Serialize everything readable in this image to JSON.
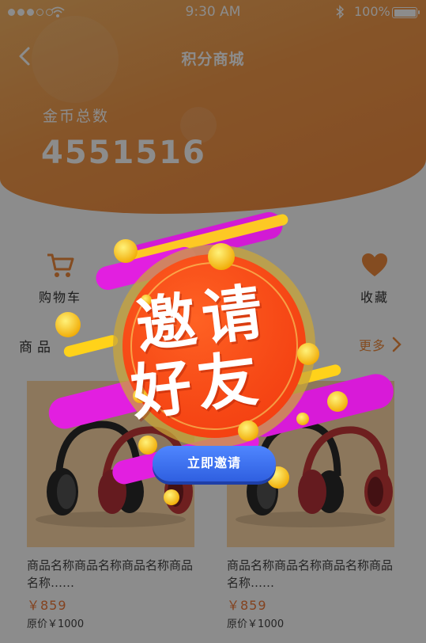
{
  "status_bar": {
    "time": "9:30 AM",
    "battery": "100%"
  },
  "nav": {
    "title": "积分商城"
  },
  "coins": {
    "label": "金币总数",
    "value": "4551516"
  },
  "quick_actions": [
    {
      "label": "购物车",
      "icon": "cart-icon"
    },
    {
      "label": "收藏",
      "icon": "heart-icon"
    }
  ],
  "products_section": {
    "title": "商品",
    "more": "更多"
  },
  "products": [
    {
      "name": "商品名称商品名称商品名称商品名称……",
      "price": "￥859",
      "original_price": "原价￥1000",
      "image": "headphones"
    },
    {
      "name": "商品名称商品名称商品名称商品名称……",
      "price": "￥859",
      "original_price": "原价￥1000",
      "image": "headphones"
    }
  ],
  "popup": {
    "title_line1": "邀请",
    "title_line2": "好友",
    "button": "立即邀请"
  },
  "colors": {
    "accent": "#f59a4a",
    "price": "#f07a3a",
    "popup_red": "#ff4a17",
    "button_blue": "#3d6ff0",
    "magenta": "#e21fe0",
    "yellow": "#ffd21a"
  }
}
